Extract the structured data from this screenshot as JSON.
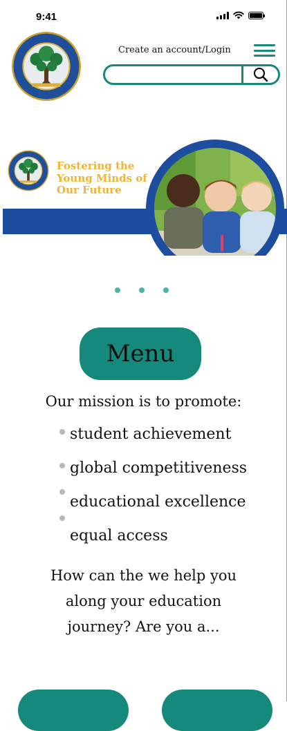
{
  "status_bar": {
    "time": "9:41"
  },
  "header": {
    "login_link": "Create an account/Login",
    "search_placeholder": ""
  },
  "hero": {
    "title": "Fostering the Young Minds of Our Future"
  },
  "carousel": {
    "dot_count": 3
  },
  "menu_button": {
    "label": "Menu"
  },
  "mission": {
    "title": "Our mission is to promote:",
    "items": [
      "student achievement",
      "global competitiveness",
      "educational excellence",
      "equal access"
    ]
  },
  "question": {
    "lines": [
      "How can the we help you",
      "along your education",
      "journey? Are you a..."
    ]
  },
  "colors": {
    "teal": "#15897b",
    "navy": "#1d4d9e",
    "gold": "#f2b533",
    "bullet": "#b8b8b8"
  }
}
